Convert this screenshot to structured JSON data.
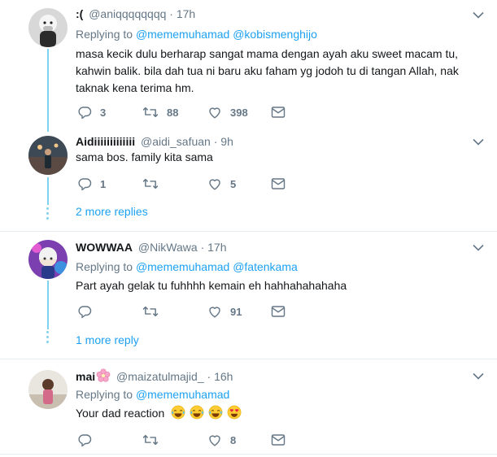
{
  "tweets": [
    {
      "name": ":(",
      "handle": "@aniqqqqqqqq",
      "sep": "·",
      "time": "17h",
      "replying_prefix": "Replying to",
      "mentions": [
        "@mememuhamad",
        "@kobismenghijo"
      ],
      "text": "masa kecik dulu berharap sangat mama dengan ayah aku sweet macam tu, kahwin balik. bila dah tua ni baru aku faham yg jodoh tu di tangan Allah, nak taknak kena terima hm.",
      "replies": "3",
      "retweets": "88",
      "likes": "398"
    },
    {
      "name": "Aidiiiiiiiiiiiii",
      "handle": "@aidi_safuan",
      "sep": "·",
      "time": "9h",
      "text": "sama bos. family kita sama",
      "replies": "1",
      "retweets": "",
      "likes": "5",
      "more_replies": "2 more replies"
    },
    {
      "name": "WOWWAA",
      "handle": "@NikWawa",
      "sep": "·",
      "time": "17h",
      "replying_prefix": "Replying to",
      "mentions": [
        "@mememuhamad",
        "@fatenkama"
      ],
      "text": "Part ayah gelak tu fuhhhh kemain eh hahhahahahaha",
      "replies": "",
      "retweets": "",
      "likes": "91",
      "more_replies": "1 more reply"
    },
    {
      "name": "mai",
      "name_emoji": "cherry-blossom",
      "handle": "@maizatulmajid_",
      "sep": "·",
      "time": "16h",
      "replying_prefix": "Replying to",
      "mentions": [
        "@mememuhamad"
      ],
      "text": "Your dad reaction",
      "text_emojis": [
        "tears-of-joy",
        "tears-of-joy",
        "tears-of-joy",
        "heart-eyes"
      ],
      "replies": "",
      "retweets": "",
      "likes": "8"
    }
  ],
  "colors": {
    "accent": "#1da1f2",
    "muted": "#657786",
    "thread_line": "#7fd3f0",
    "divider": "#e6ecf0"
  },
  "icons": {
    "reply": "reply-icon",
    "retweet": "retweet-icon",
    "like": "heart-icon",
    "dm": "envelope-icon",
    "caret": "chevron-down-icon"
  }
}
